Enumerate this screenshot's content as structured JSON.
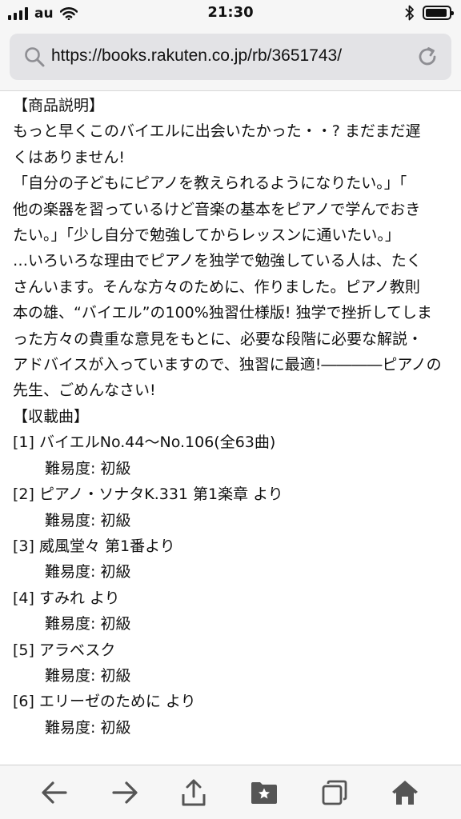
{
  "status_bar": {
    "carrier": "au",
    "time": "21:30"
  },
  "url_bar": {
    "url": "https://books.rakuten.co.jp/rb/3651743/"
  },
  "content": {
    "lines": [
      "【商品説明】",
      "もっと早くこのバイエルに出会いたかった・・? まだまだ遅",
      "くはありません!",
      "「自分の子どもにピアノを教えられるようになりたい。」「",
      "他の楽器を習っているけど音楽の基本をピアノで学んでおき",
      "たい。」「少し自分で勉強してからレッスンに通いたい。」",
      "…いろいろな理由でピアノを独学で勉強している人は、たく",
      "さんいます。そんな方々のために、作りました。ピアノ教則",
      "本の雄、“バイエル”の100%独習仕様版! 独学で挫折してしま",
      "った方々の貴重な意見をもとに、必要な段階に必要な解説・",
      "アドバイスが入っていますので、独習に最適!――――ピアノの",
      "先生、ごめんなさい!",
      "【収載曲】"
    ],
    "songs": [
      {
        "title": "[1] バイエルNo.44〜No.106(全63曲)",
        "difficulty": "難易度: 初級"
      },
      {
        "title": "[2] ピアノ・ソナタK.331 第1楽章 より",
        "difficulty": "難易度: 初級"
      },
      {
        "title": "[3] 威風堂々 第1番より",
        "difficulty": "難易度: 初級"
      },
      {
        "title": "[4] すみれ より",
        "difficulty": "難易度: 初級"
      },
      {
        "title": "[5] アラベスク",
        "difficulty": "難易度: 初級"
      },
      {
        "title": "[6] エリーゼのために より",
        "difficulty": "難易度: 初級"
      }
    ]
  },
  "toolbar": {
    "icons": [
      "back-icon",
      "forward-icon",
      "share-icon",
      "bookmarks-icon",
      "tabs-icon",
      "home-icon"
    ]
  }
}
